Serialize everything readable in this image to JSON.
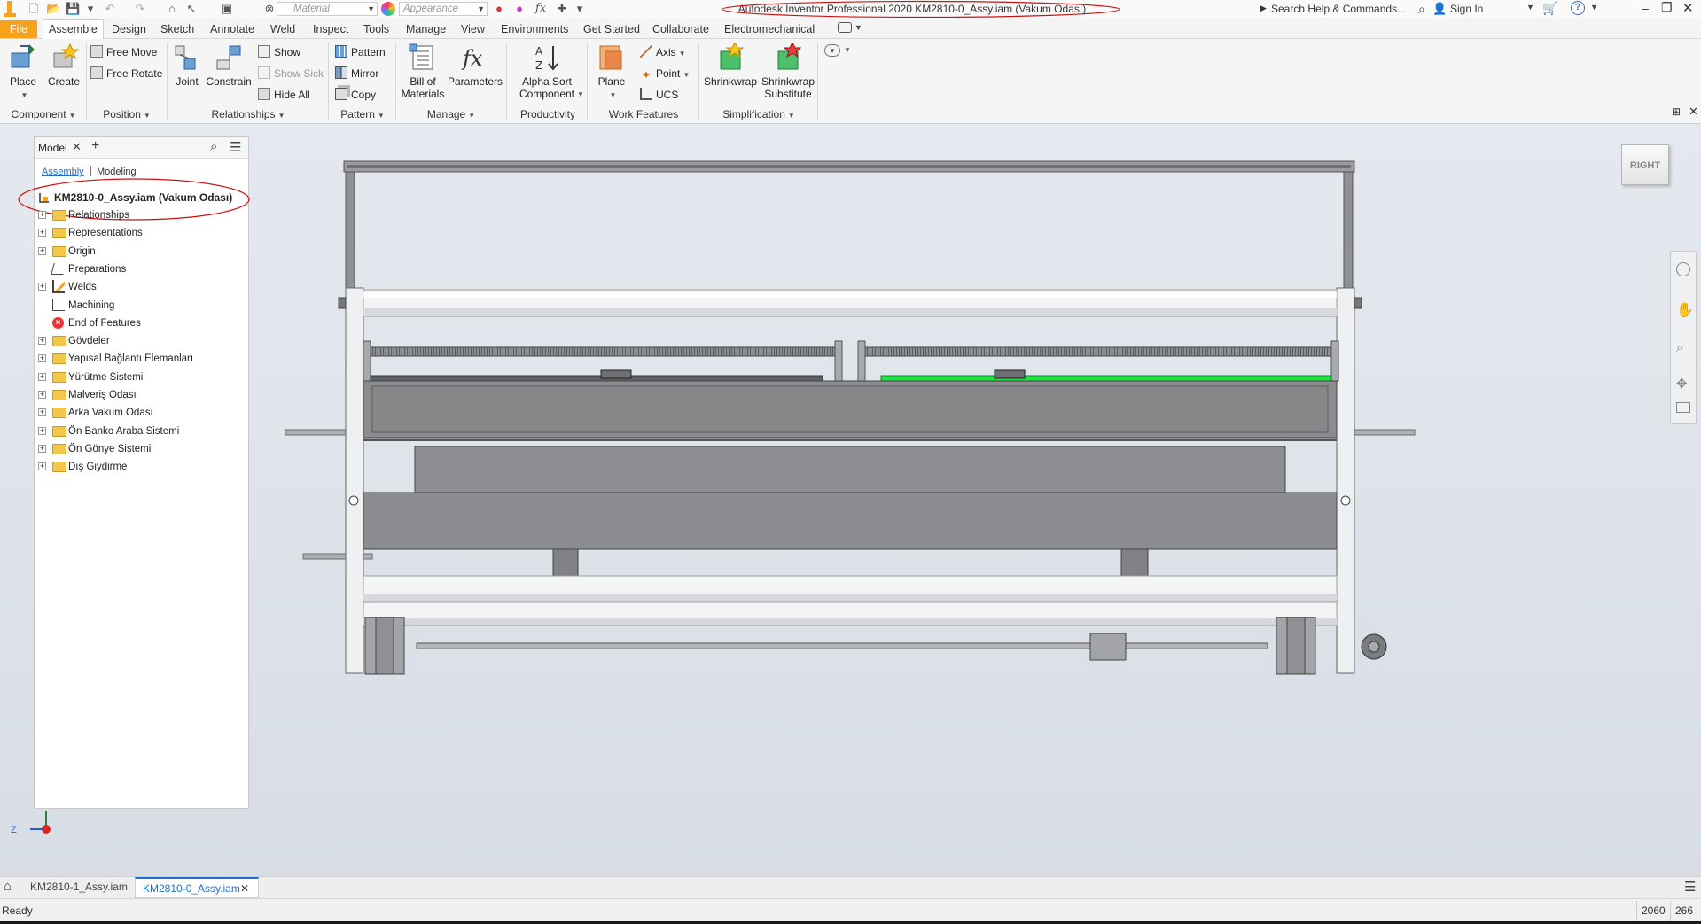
{
  "titlebar": {
    "material": "Material",
    "appearance": "Appearance",
    "title": "Autodesk Inventor Professional 2020   KM2810-0_Assy.iam (Vakum Odası)",
    "search": "Search Help & Commands...",
    "signin": "Sign In"
  },
  "tabs": [
    "File",
    "Assemble",
    "Design",
    "Sketch",
    "Annotate",
    "Weld",
    "Inspect",
    "Tools",
    "Manage",
    "View",
    "Environments",
    "Get Started",
    "Collaborate",
    "Electromechanical"
  ],
  "ribbon": {
    "place": "Place",
    "create": "Create",
    "free_move": "Free Move",
    "free_rotate": "Free Rotate",
    "joint": "Joint",
    "constrain": "Constrain",
    "show": "Show",
    "show_sick": "Show Sick",
    "hide_all": "Hide All",
    "pattern": "Pattern",
    "mirror": "Mirror",
    "copy": "Copy",
    "bom": "Bill of\nMaterials",
    "parameters": "Parameters",
    "alpha_sort": "Alpha Sort\nComponent",
    "plane": "Plane",
    "axis": "Axis",
    "point": "Point",
    "ucs": "UCS",
    "shrinkwrap": "Shrinkwrap",
    "shrinkwrap_sub": "Shrinkwrap\nSubstitute",
    "groups": {
      "component": "Component",
      "position": "Position",
      "relationships": "Relationships",
      "pattern": "Pattern",
      "manage": "Manage",
      "productivity": "Productivity",
      "work_features": "Work Features",
      "simplification": "Simplification"
    }
  },
  "browser": {
    "tab": "Model",
    "subtab_assembly": "Assembly",
    "subtab_modeling": "Modeling",
    "root": "KM2810-0_Assy.iam (Vakum Odası)",
    "items": [
      {
        "label": "Relationships",
        "expand": true,
        "icon": "folder"
      },
      {
        "label": "Representations",
        "expand": true,
        "icon": "folder"
      },
      {
        "label": "Origin",
        "expand": true,
        "icon": "folder"
      },
      {
        "label": "Preparations",
        "expand": false,
        "icon": "prep"
      },
      {
        "label": "Welds",
        "expand": true,
        "icon": "weld"
      },
      {
        "label": "Machining",
        "expand": false,
        "icon": "machining"
      },
      {
        "label": "End of Features",
        "expand": false,
        "icon": "end"
      },
      {
        "label": "Gövdeler",
        "expand": true,
        "icon": "folder"
      },
      {
        "label": "Yapısal Bağlantı Elemanları",
        "expand": true,
        "icon": "folder"
      },
      {
        "label": "Yürütme Sistemi",
        "expand": true,
        "icon": "folder"
      },
      {
        "label": "Malveriş Odası",
        "expand": true,
        "icon": "folder"
      },
      {
        "label": "Arka Vakum Odası",
        "expand": true,
        "icon": "folder"
      },
      {
        "label": "Ön Banko Araba Sistemi",
        "expand": true,
        "icon": "folder"
      },
      {
        "label": "Ön Gönye Sistemi",
        "expand": true,
        "icon": "folder"
      },
      {
        "label": "Dış Giydirme",
        "expand": true,
        "icon": "folder"
      }
    ]
  },
  "viewcube": "RIGHT",
  "doc_tabs": [
    "KM2810-1_Assy.iam",
    "KM2810-0_Assy.iam"
  ],
  "status": {
    "text": "Ready",
    "count1": "2060",
    "count2": "266"
  },
  "colors": {
    "accent": "#f7a21b",
    "highlight_green": "#22e046",
    "annotation_red": "#cc1111",
    "viewport_bg": "#dde2e9"
  }
}
